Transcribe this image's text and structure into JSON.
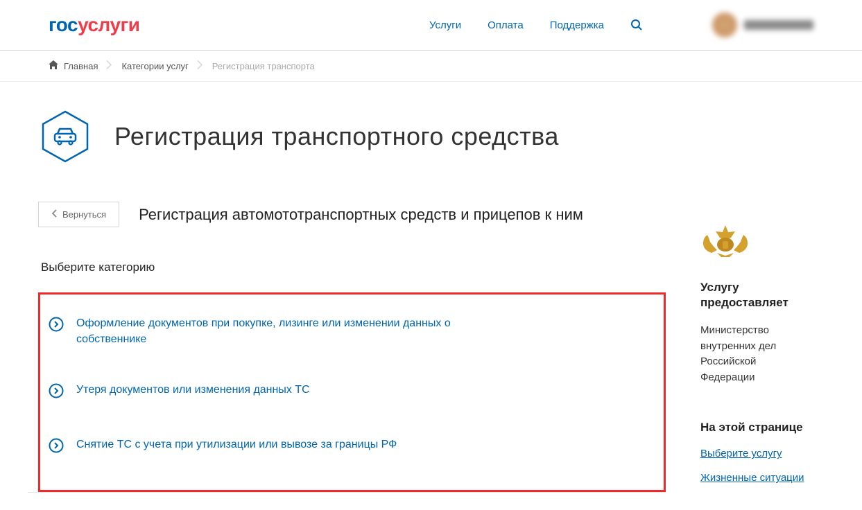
{
  "logo": {
    "part1": "гос",
    "part2": "услуги"
  },
  "nav": {
    "services": "Услуги",
    "payment": "Оплата",
    "support": "Поддержка"
  },
  "breadcrumb": {
    "home": "Главная",
    "categories": "Категории услуг",
    "current": "Регистрация транспорта"
  },
  "page_title": "Регистрация транспортного средства",
  "back_button": "Вернуться",
  "subtitle": "Регистрация автомототранспортных средств и прицепов к ним",
  "choose_label": "Выберите категорию",
  "categories": [
    "Оформление документов при покупке, лизинге или изменении данных о собственнике",
    "Утеря документов или изменения данных ТС",
    "Снятие ТС с учета при утилизации или вывозе за границы РФ"
  ],
  "sidebar": {
    "provides_heading": "Услугу предоставляет",
    "provider": "Министерство внутренних дел Российской Федерации",
    "on_page_heading": "На этой странице",
    "link1": "Выберите услугу",
    "link2": "Жизненные ситуации"
  }
}
